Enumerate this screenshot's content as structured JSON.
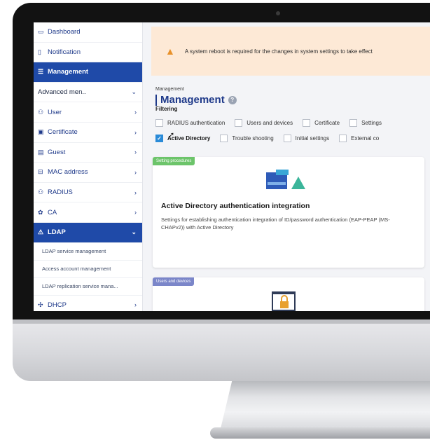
{
  "sidebar": {
    "items": [
      {
        "icon": "▭",
        "label": "Dashboard",
        "chevron": ""
      },
      {
        "icon": "▯",
        "label": "Notification",
        "chevron": ""
      },
      {
        "icon": "☰",
        "label": "Management",
        "chevron": ""
      },
      {
        "icon": "",
        "label": "Advanced men..",
        "chevron": "⌄"
      },
      {
        "icon": "⚇",
        "label": "User",
        "chevron": "›"
      },
      {
        "icon": "▣",
        "label": "Certificate",
        "chevron": "›"
      },
      {
        "icon": "▤",
        "label": "Guest",
        "chevron": "›"
      },
      {
        "icon": "⊟",
        "label": "MAC address",
        "chevron": "›"
      },
      {
        "icon": "⚇",
        "label": "RADIUS",
        "chevron": "›"
      },
      {
        "icon": "✿",
        "label": "CA",
        "chevron": "›"
      },
      {
        "icon": "⚠",
        "label": "LDAP",
        "chevron": "⌄"
      }
    ],
    "ldap_subitems": [
      "LDAP service management",
      "Access account management",
      "LDAP replication service mana..."
    ],
    "dhcp": {
      "icon": "✣",
      "label": "DHCP",
      "chevron": "›"
    }
  },
  "alert": {
    "icon": "warning-icon",
    "text": "A system reboot is required for the changes in system settings to take effect"
  },
  "breadcrumb": "Management",
  "page_title": "Management",
  "filtering_label": "Filtering",
  "filters_row1": [
    {
      "label": "RADIUS authentication",
      "checked": false
    },
    {
      "label": "Users and devices",
      "checked": false
    },
    {
      "label": "Certificate",
      "checked": false
    },
    {
      "label": "Settings",
      "checked": false
    }
  ],
  "filters_row2": [
    {
      "label": "Active Directory",
      "checked": true
    },
    {
      "label": "Trouble shooting",
      "checked": false
    },
    {
      "label": "Initial settings",
      "checked": false
    },
    {
      "label": "External co",
      "checked": false
    }
  ],
  "cards": [
    {
      "tag": "Setting procedures",
      "title": "Active Directory authentication integration",
      "description": "Settings for establishing authentication integration of ID/password authentication (EAP-PEAP (MS-CHAPv2)) with Active Directory"
    },
    {
      "tag": "Users and devices",
      "title": "",
      "description": ""
    }
  ],
  "colors": {
    "accent": "#1f4aa8",
    "alert_bg": "#fde9d6",
    "tag_green": "#6cc46a",
    "tag_purple": "#7b86c9",
    "check_blue": "#2a8bd8"
  }
}
